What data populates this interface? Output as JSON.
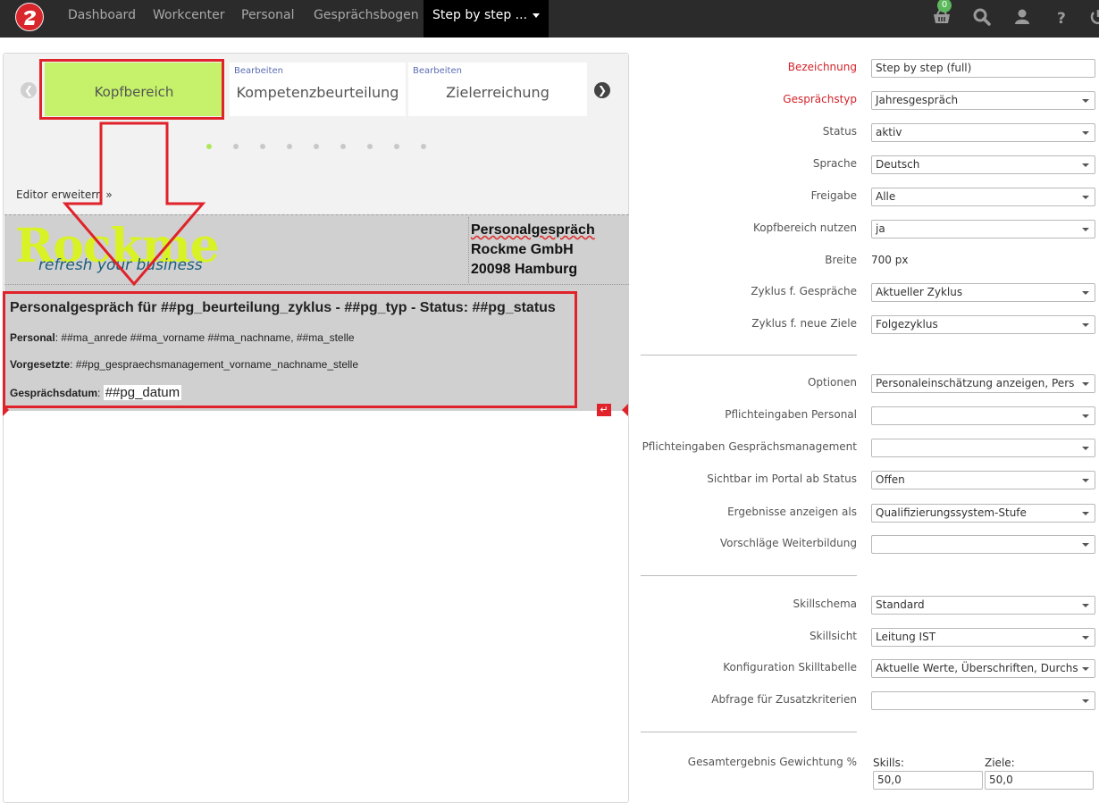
{
  "nav": {
    "items": [
      "Dashboard",
      "Workcenter",
      "Personal",
      "Gesprächsbogen"
    ],
    "active": "Step by step ...",
    "cart_count": "0"
  },
  "carousel": {
    "slides": [
      {
        "edit": "",
        "title": "Kopfbereich"
      },
      {
        "edit": "Bearbeiten",
        "title": "Kompetenzbeurteilung"
      },
      {
        "edit": "Bearbeiten",
        "title": "Zielerreichung"
      }
    ],
    "expand_label": "Editor erweitern"
  },
  "editor": {
    "logo_main": "Rockme",
    "logo_tagline": "refresh your business",
    "company_lines": [
      "Personalgespräch",
      "Rockme GmbH",
      "20098 Hamburg"
    ],
    "title": "Personalgespräch für ##pg_beurteilung_zyklus - ##pg_typ - Status: ##pg_status",
    "personal_label": "Personal",
    "personal_value": ": ##ma_anrede ##ma_vorname ##ma_nachname, ##ma_stelle",
    "vorgesetzte_label": "Vorgesetzte",
    "vorgesetzte_value": ": ##pg_gespraechsmanagement_vorname_nachname_stelle",
    "datum_label": "Gesprächsdatum",
    "datum_value": "##pg_datum"
  },
  "form": {
    "rows": [
      {
        "label": "Bezeichnung",
        "value": "Step by step (full)",
        "type": "text",
        "required": true
      },
      {
        "label": "Gesprächstyp",
        "value": "Jahresgespräch",
        "type": "select",
        "required": true
      },
      {
        "label": "Status",
        "value": "aktiv",
        "type": "select"
      },
      {
        "label": "Sprache",
        "value": "Deutsch",
        "type": "select"
      },
      {
        "label": "Freigabe",
        "value": "Alle",
        "type": "select"
      },
      {
        "label": "Kopfbereich nutzen",
        "value": "ja",
        "type": "select"
      },
      {
        "label": "Breite",
        "value": "700 px",
        "type": "static"
      },
      {
        "label": "Zyklus f. Gespräche",
        "value": "Aktueller Zyklus",
        "type": "select"
      },
      {
        "label": "Zyklus f. neue Ziele",
        "value": "Folgezyklus",
        "type": "select"
      },
      {
        "label": "Optionen",
        "value": "Personaleinschätzung anzeigen, Pers",
        "type": "select"
      },
      {
        "label": "Pflichteingaben Personal",
        "value": "",
        "type": "select"
      },
      {
        "label": "Pflichteingaben Gesprächsmanagement",
        "value": "",
        "type": "select"
      },
      {
        "label": "Sichtbar im Portal ab Status",
        "value": "Offen",
        "type": "select"
      },
      {
        "label": "Ergebnisse anzeigen als",
        "value": "Qualifizierungssystem-Stufe",
        "type": "select"
      },
      {
        "label": "Vorschläge Weiterbildung",
        "value": "",
        "type": "select"
      },
      {
        "label": "Skillschema",
        "value": "Standard",
        "type": "select"
      },
      {
        "label": "Skillsicht",
        "value": "Leitung IST",
        "type": "select"
      },
      {
        "label": "Konfiguration Skilltabelle",
        "value": "Aktuelle Werte, Überschriften, Durchs",
        "type": "select"
      },
      {
        "label": "Abfrage für Zusatzkriterien",
        "value": "",
        "type": "select"
      }
    ],
    "gewichtung": {
      "label": "Gesamtergebnis Gewichtung %",
      "skills_label": "Skills:",
      "skills_value": "50,0",
      "ziele_label": "Ziele:",
      "ziele_value": "50,0"
    }
  },
  "colors": {
    "accent_red": "#d2232a",
    "highlight_green": "#c5f26a",
    "navbar_bg": "#2b2b2b"
  }
}
